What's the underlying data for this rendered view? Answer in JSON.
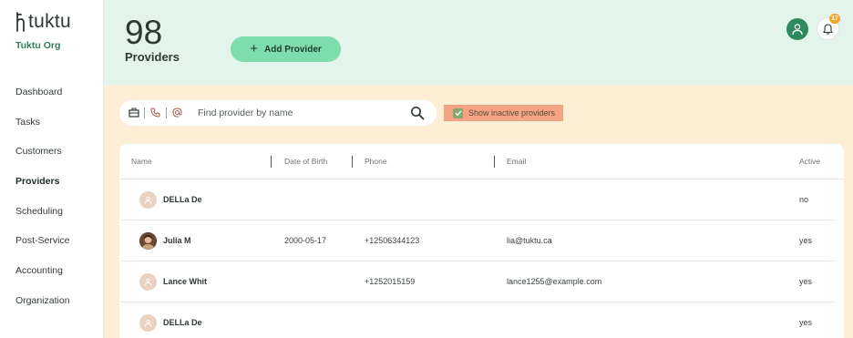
{
  "app": {
    "brand": "tuktu",
    "org": "Tuktu Org"
  },
  "nav": {
    "items": [
      {
        "label": "Dashboard"
      },
      {
        "label": "Tasks"
      },
      {
        "label": "Customers"
      },
      {
        "label": "Providers",
        "active": true
      },
      {
        "label": "Scheduling"
      },
      {
        "label": "Post-Service"
      },
      {
        "label": "Accounting"
      },
      {
        "label": "Organization"
      }
    ]
  },
  "header": {
    "count": "98",
    "count_label": "Providers",
    "add_label": "Add Provider",
    "notification_count": "17"
  },
  "search": {
    "placeholder": "Find provider by name",
    "show_inactive_label": "Show inactive providers",
    "show_inactive_checked": true
  },
  "table": {
    "columns": [
      "Name",
      "Date of Birth",
      "Phone",
      "Email",
      "Active"
    ],
    "rows": [
      {
        "name": "DELLa De",
        "dob": "",
        "phone": "",
        "email": "",
        "active": "no",
        "avatar": "placeholder"
      },
      {
        "name": "Julia M",
        "dob": "2000-05-17",
        "phone": "+12506344123",
        "email": "lia@tuktu.ca",
        "active": "yes",
        "avatar": "photo"
      },
      {
        "name": "Lance Whit",
        "dob": "",
        "phone": "+1252015159",
        "email": "lance1255@example.com",
        "active": "yes",
        "avatar": "placeholder"
      },
      {
        "name": "DELLa De",
        "dob": "",
        "phone": "",
        "email": "",
        "active": "yes",
        "avatar": "placeholder"
      }
    ]
  },
  "colors": {
    "header_bg": "#e3f4ec",
    "main_bg": "#fcefd5",
    "accent_green": "#7fdcac",
    "brand_green": "#2e7d5b",
    "badge": "#f0a832",
    "highlight": "#f4a480"
  },
  "icons": [
    "logo-mark-icon",
    "plus-icon",
    "user-icon",
    "bell-icon",
    "briefcase-icon",
    "phone-icon",
    "at-icon",
    "search-icon",
    "checkbox-checked-icon"
  ]
}
